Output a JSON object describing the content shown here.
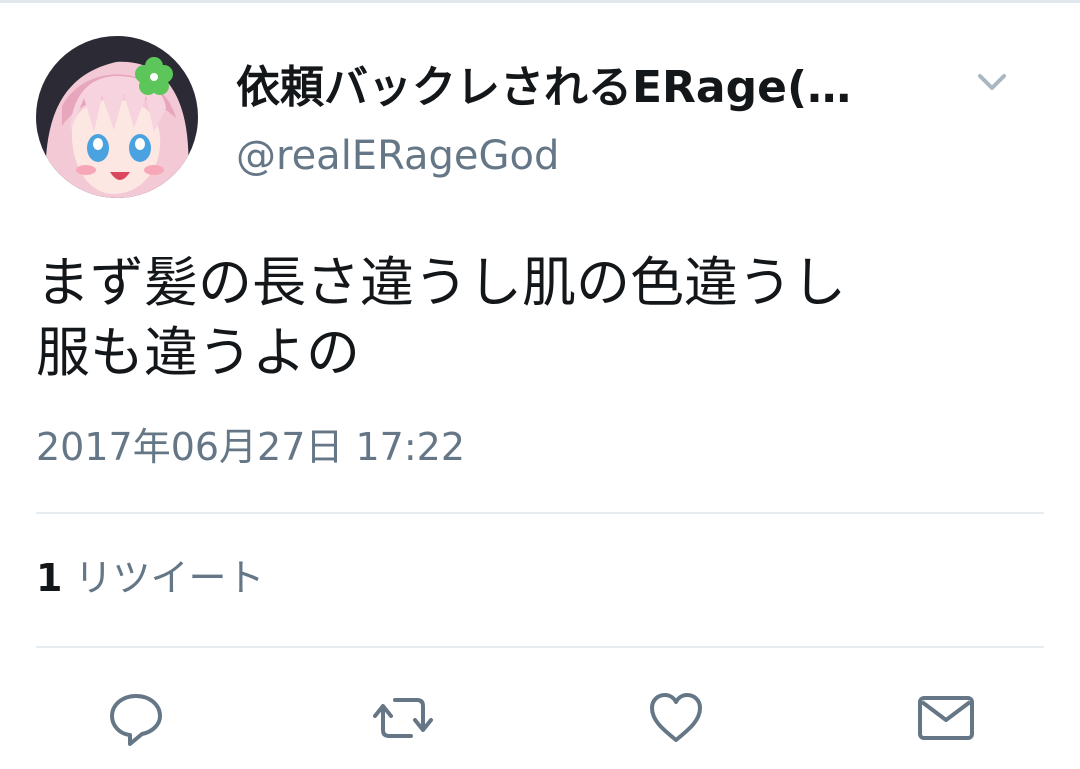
{
  "tweet": {
    "author": {
      "display_name": "依頼バックレされるERage(…",
      "screen_name": "@realERageGod",
      "avatar_icon": "anime-avatar-icon"
    },
    "text_lines": [
      "まず髪の長さ違うし肌の色違うし",
      "服も違うよの"
    ],
    "timestamp": "2017年06月27日 17:22",
    "stats": {
      "retweet_count": "1",
      "retweet_label": "リツイート"
    },
    "actions": [
      {
        "name": "reply",
        "icon": "reply-icon"
      },
      {
        "name": "retweet",
        "icon": "retweet-icon"
      },
      {
        "name": "like",
        "icon": "heart-icon"
      },
      {
        "name": "direct-message",
        "icon": "envelope-icon"
      }
    ]
  },
  "colors": {
    "primary_text": "#14171a",
    "secondary_text": "#657786",
    "divider": "#e6ecf0",
    "icon": "#657786"
  }
}
